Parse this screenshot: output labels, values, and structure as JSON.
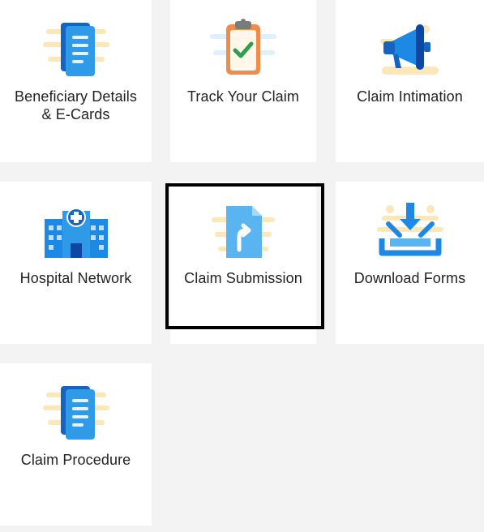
{
  "tiles": [
    {
      "label": "Beneficiary Details\n& E-Cards",
      "icon": "document-list-icon"
    },
    {
      "label": "Track Your Claim",
      "icon": "clipboard-check-icon"
    },
    {
      "label": "Claim Intimation",
      "icon": "megaphone-icon"
    },
    {
      "label": "Hospital Network",
      "icon": "hospital-icon"
    },
    {
      "label": "Claim Submission",
      "icon": "file-upload-icon"
    },
    {
      "label": "Download Forms",
      "icon": "download-tray-icon"
    },
    {
      "label": "Claim Procedure",
      "icon": "document-list-icon"
    }
  ],
  "highlighted_tile": "Claim Submission",
  "colors": {
    "page_bg": "#f3f3f3",
    "tile_bg": "#ffffff",
    "primary_blue": "#1e88e5",
    "light_blue": "#5ab4f0",
    "accent_yellow": "#fbe7b8",
    "check_green": "#2e9e4f",
    "clipboard_orange": "#f08b4a"
  }
}
